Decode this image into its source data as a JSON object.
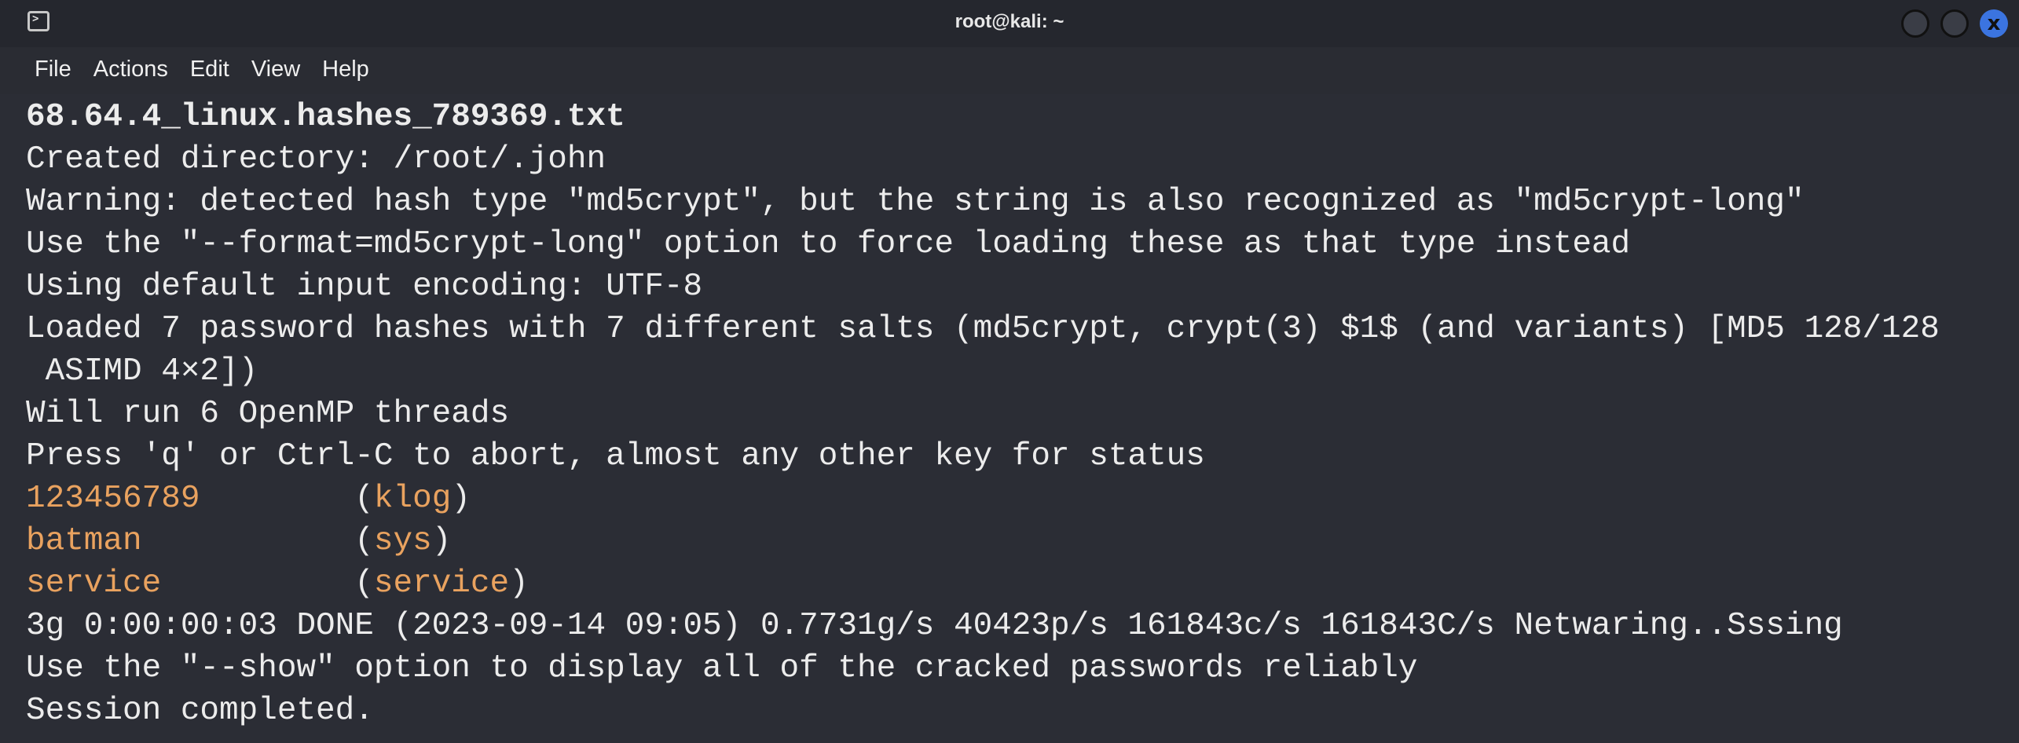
{
  "window": {
    "title": "root@kali: ~",
    "menu": [
      "File",
      "Actions",
      "Edit",
      "View",
      "Help"
    ],
    "close_label": "x"
  },
  "terminal": {
    "lines": [
      "68.64.4_linux.hashes_789369.txt",
      "Created directory: /root/.john",
      "Warning: detected hash type \"md5crypt\", but the string is also recognized as \"md5crypt-long\"",
      "Use the \"--format=md5crypt-long\" option to force loading these as that type instead",
      "Using default input encoding: UTF-8",
      "Loaded 7 password hashes with 7 different salts (md5crypt, crypt(3) $1$ (and variants) [MD5 128/128",
      " ASIMD 4×2])",
      "Will run 6 OpenMP threads",
      "Press 'q' or Ctrl-C to abort, almost any other key for status"
    ],
    "cracked": [
      {
        "password": "123456789",
        "user": "klog"
      },
      {
        "password": "batman",
        "user": "sys"
      },
      {
        "password": "service",
        "user": "service"
      }
    ],
    "tail": [
      "3g 0:00:00:03 DONE (2023-09-14 09:05) 0.7731g/s 40423p/s 161843c/s 161843C/s Netwaring..Sssing",
      "Use the \"--show\" option to display all of the cracked passwords reliably",
      "Session completed."
    ]
  },
  "colors": {
    "background": "#2b2d35",
    "highlight": "#e9a25f",
    "close_button": "#3b74e0"
  }
}
